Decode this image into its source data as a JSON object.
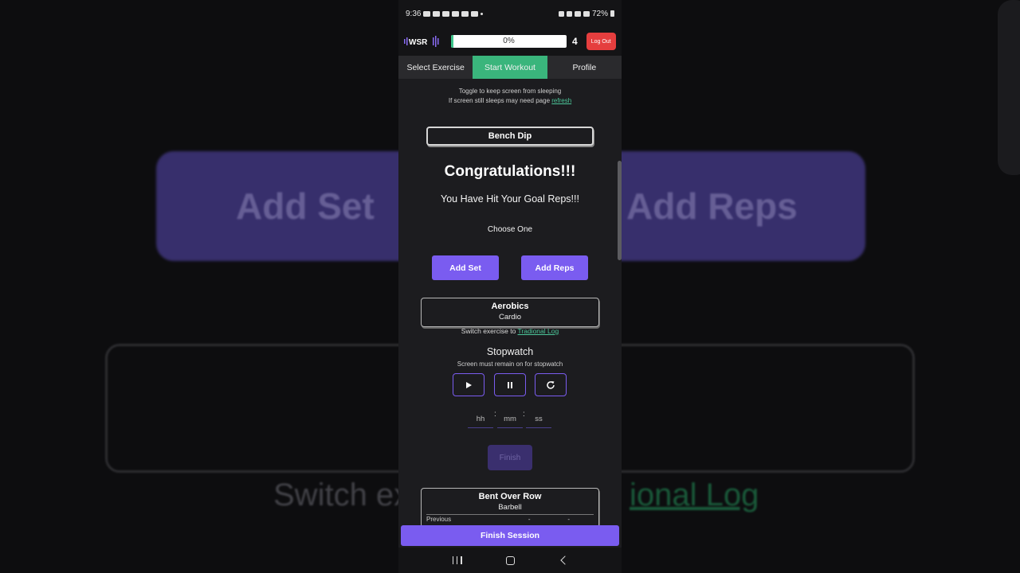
{
  "background": {
    "add_set": "Add Set",
    "add_reps": "Add Reps",
    "switch_prefix": "Switch ex",
    "switch_link": "ional Log"
  },
  "status_bar": {
    "time": "9:36",
    "battery": "72%"
  },
  "app_bar": {
    "logo": "WSR",
    "progress_text": "0%",
    "progress_value": 0.02,
    "count": "4",
    "logout_label": "Log Out"
  },
  "tabs": [
    {
      "label": "Select Exercise",
      "active": false
    },
    {
      "label": "Start Workout",
      "active": true
    },
    {
      "label": "Profile",
      "active": false
    }
  ],
  "toggle_note": {
    "line1": "Toggle to keep screen from sleeping",
    "line2_prefix": "If screen still sleeps may need page ",
    "line2_link": "refresh"
  },
  "current_exercise": {
    "name": "Bench Dip",
    "congrats": "Congratulations!!!",
    "goal_message": "You Have Hit Your Goal Reps!!!",
    "choose": "Choose One",
    "add_set_label": "Add Set",
    "add_reps_label": "Add Reps"
  },
  "cardio_exercise": {
    "name": "Aerobics",
    "category": "Cardio",
    "switch_prefix": "Switch exercise to ",
    "switch_link": "Tradional Log"
  },
  "stopwatch": {
    "title": "Stopwatch",
    "note": "Screen must remain on for stopwatch",
    "hh_placeholder": "hh",
    "mm_placeholder": "mm",
    "ss_placeholder": "ss",
    "separator": ":",
    "finish_label": "Finish"
  },
  "next_exercise": {
    "name": "Bent Over Row",
    "category": "Barbell",
    "previous_label": "Previous",
    "previous_val1": "-",
    "previous_val2": "-"
  },
  "finish_session_label": "Finish Session",
  "colors": {
    "accent_purple": "#7a5cf0",
    "tab_active_green": "#3ab57c",
    "logout_red": "#e53e3e",
    "link_green": "#4cc79a"
  },
  "icons": {
    "play": "play-icon",
    "pause": "pause-icon",
    "reset": "refresh-icon"
  }
}
